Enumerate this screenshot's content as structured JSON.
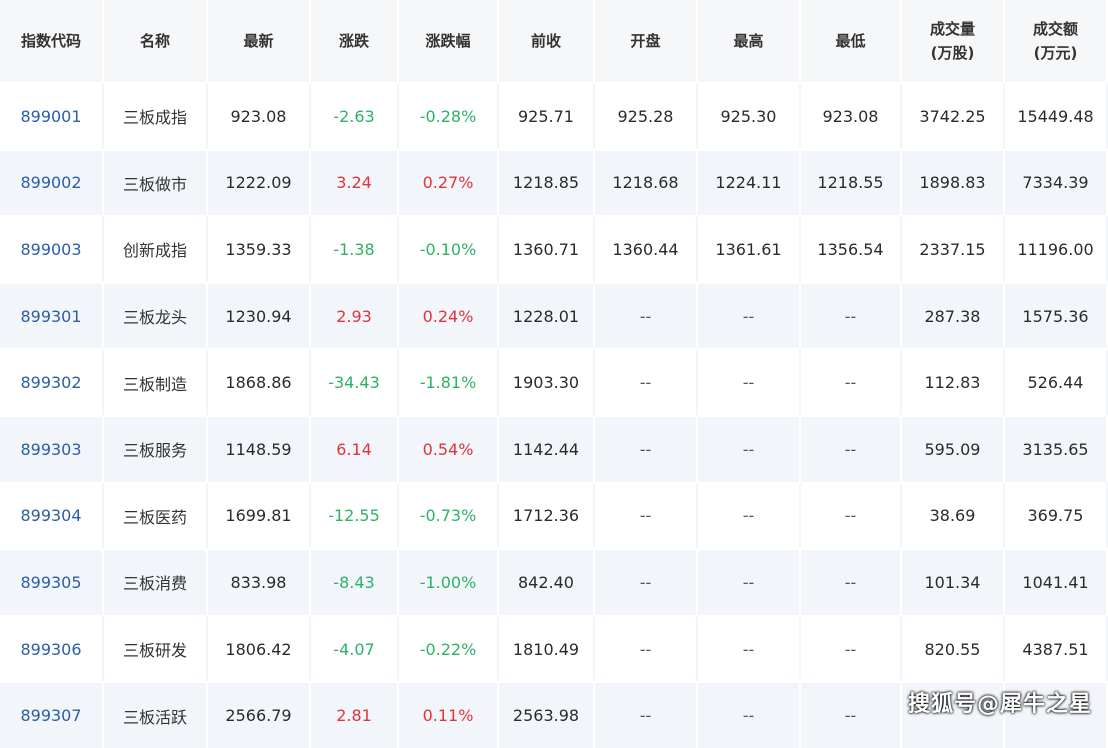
{
  "colors": {
    "up": "#e0343a",
    "down": "#2eb266",
    "code": "#2a5ea8",
    "header_bg": "#f6f7f9",
    "stripe_bg": "#f2f6fb"
  },
  "table": {
    "headers": [
      "指数代码",
      "名称",
      "最新",
      "涨跌",
      "涨跌幅",
      "前收",
      "开盘",
      "最高",
      "最低",
      "成交量\n(万股)",
      "成交额\n(万元)"
    ],
    "rows": [
      {
        "code": "899001",
        "name": "三板成指",
        "last": "923.08",
        "change": "-2.63",
        "pct": "-0.28%",
        "prev": "925.71",
        "open": "925.28",
        "high": "925.30",
        "low": "923.08",
        "vol": "3742.25",
        "amt": "15449.48",
        "dir": "down"
      },
      {
        "code": "899002",
        "name": "三板做市",
        "last": "1222.09",
        "change": "3.24",
        "pct": "0.27%",
        "prev": "1218.85",
        "open": "1218.68",
        "high": "1224.11",
        "low": "1218.55",
        "vol": "1898.83",
        "amt": "7334.39",
        "dir": "up"
      },
      {
        "code": "899003",
        "name": "创新成指",
        "last": "1359.33",
        "change": "-1.38",
        "pct": "-0.10%",
        "prev": "1360.71",
        "open": "1360.44",
        "high": "1361.61",
        "low": "1356.54",
        "vol": "2337.15",
        "amt": "11196.00",
        "dir": "down"
      },
      {
        "code": "899301",
        "name": "三板龙头",
        "last": "1230.94",
        "change": "2.93",
        "pct": "0.24%",
        "prev": "1228.01",
        "open": "--",
        "high": "--",
        "low": "--",
        "vol": "287.38",
        "amt": "1575.36",
        "dir": "up"
      },
      {
        "code": "899302",
        "name": "三板制造",
        "last": "1868.86",
        "change": "-34.43",
        "pct": "-1.81%",
        "prev": "1903.30",
        "open": "--",
        "high": "--",
        "low": "--",
        "vol": "112.83",
        "amt": "526.44",
        "dir": "down"
      },
      {
        "code": "899303",
        "name": "三板服务",
        "last": "1148.59",
        "change": "6.14",
        "pct": "0.54%",
        "prev": "1142.44",
        "open": "--",
        "high": "--",
        "low": "--",
        "vol": "595.09",
        "amt": "3135.65",
        "dir": "up"
      },
      {
        "code": "899304",
        "name": "三板医药",
        "last": "1699.81",
        "change": "-12.55",
        "pct": "-0.73%",
        "prev": "1712.36",
        "open": "--",
        "high": "--",
        "low": "--",
        "vol": "38.69",
        "amt": "369.75",
        "dir": "down"
      },
      {
        "code": "899305",
        "name": "三板消费",
        "last": "833.98",
        "change": "-8.43",
        "pct": "-1.00%",
        "prev": "842.40",
        "open": "--",
        "high": "--",
        "low": "--",
        "vol": "101.34",
        "amt": "1041.41",
        "dir": "down"
      },
      {
        "code": "899306",
        "name": "三板研发",
        "last": "1806.42",
        "change": "-4.07",
        "pct": "-0.22%",
        "prev": "1810.49",
        "open": "--",
        "high": "--",
        "low": "--",
        "vol": "820.55",
        "amt": "4387.51",
        "dir": "down"
      },
      {
        "code": "899307",
        "name": "三板活跃",
        "last": "2566.79",
        "change": "2.81",
        "pct": "0.11%",
        "prev": "2563.98",
        "open": "--",
        "high": "--",
        "low": "--",
        "vol": "",
        "amt": "",
        "dir": "up"
      }
    ]
  },
  "watermark": "搜狐号@犀牛之星"
}
